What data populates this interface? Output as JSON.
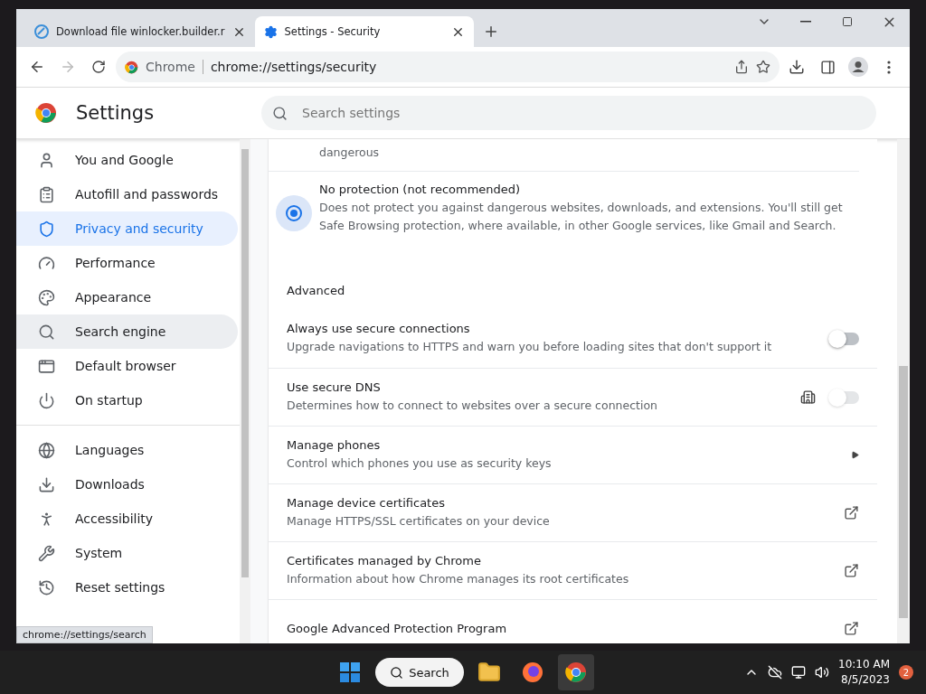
{
  "tabs": [
    {
      "title": "Download file winlocker.builder.r",
      "selected": false
    },
    {
      "title": "Settings - Security",
      "selected": true
    }
  ],
  "address": {
    "chip": "Chrome",
    "url": "chrome://settings/security"
  },
  "settings": {
    "title": "Settings",
    "search_placeholder": "Search settings"
  },
  "sidebar": {
    "groups": [
      [
        {
          "label": "You and Google",
          "selected": false,
          "hovered": false
        },
        {
          "label": "Autofill and passwords",
          "selected": false,
          "hovered": false
        },
        {
          "label": "Privacy and security",
          "selected": true,
          "hovered": false
        },
        {
          "label": "Performance",
          "selected": false,
          "hovered": false
        },
        {
          "label": "Appearance",
          "selected": false,
          "hovered": false
        },
        {
          "label": "Search engine",
          "selected": false,
          "hovered": true
        },
        {
          "label": "Default browser",
          "selected": false,
          "hovered": false
        },
        {
          "label": "On startup",
          "selected": false,
          "hovered": false
        }
      ],
      [
        {
          "label": "Languages",
          "selected": false,
          "hovered": false
        },
        {
          "label": "Downloads",
          "selected": false,
          "hovered": false
        },
        {
          "label": "Accessibility",
          "selected": false,
          "hovered": false
        },
        {
          "label": "System",
          "selected": false,
          "hovered": false
        },
        {
          "label": "Reset settings",
          "selected": false,
          "hovered": false
        }
      ]
    ]
  },
  "content": [
    {
      "kind": "fragment",
      "text": "dangerous"
    },
    {
      "kind": "radio",
      "title": "No protection (not recommended)",
      "description": "Does not protect you against dangerous websites, downloads, and extensions. You'll still get Safe Browsing protection, where available, in other Google services, like Gmail and Search.",
      "selected": true
    },
    {
      "kind": "heading",
      "title": "Advanced"
    },
    {
      "kind": "toggle",
      "title": "Always use secure connections",
      "description": "Upgrade navigations to HTTPS and warn you before loading sites that don't support it",
      "on": false,
      "disabled": false
    },
    {
      "kind": "toggle",
      "title": "Use secure DNS",
      "description": "Determines how to connect to websites over a secure connection",
      "on": false,
      "disabled": true,
      "managed": true
    },
    {
      "kind": "arrow",
      "title": "Manage phones",
      "description": "Control which phones you use as security keys"
    },
    {
      "kind": "external",
      "title": "Manage device certificates",
      "description": "Manage HTTPS/SSL certificates on your device"
    },
    {
      "kind": "external",
      "title": "Certificates managed by Chrome",
      "description": "Information about how Chrome manages its root certificates"
    },
    {
      "kind": "external",
      "title": "Google Advanced Protection Program"
    }
  ],
  "status_bubble": "chrome://settings/search",
  "taskbar": {
    "search": "Search",
    "time": "10:10 AM",
    "date": "8/5/2023",
    "notifications": "2"
  }
}
